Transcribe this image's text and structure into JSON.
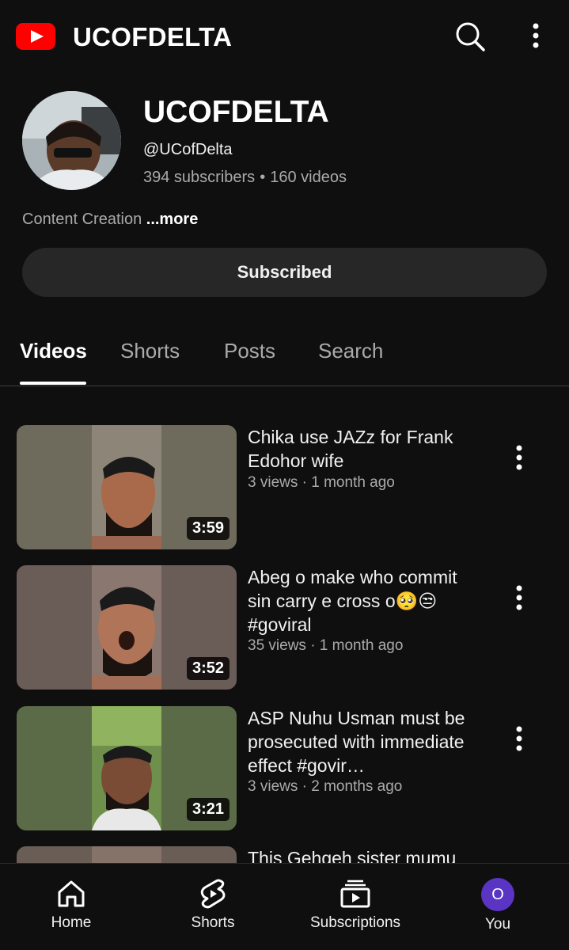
{
  "header": {
    "app_title": "UCOFDELTA",
    "logo_icon": "youtube-logo-icon",
    "search_icon": "search-icon",
    "more_icon": "more-vert-icon"
  },
  "channel": {
    "name": "UCOFDELTA",
    "handle": "@UCofDelta",
    "subscribers": "394 subscribers",
    "videos_count": "160 videos",
    "description": "Content Creation",
    "more_label": "...more",
    "subscribe_button": "Subscribed"
  },
  "tabs": [
    {
      "label": "Videos",
      "active": true
    },
    {
      "label": "Shorts",
      "active": false
    },
    {
      "label": "Posts",
      "active": false
    },
    {
      "label": "Search",
      "active": false
    }
  ],
  "videos": [
    {
      "title": "Chika use JAZz for Frank Edohor wife",
      "meta": "3 views · 1 month ago",
      "duration": "3:59"
    },
    {
      "title": "Abeg o make who commit sin carry e cross o🥺😒 #goviral",
      "meta": "35 views · 1 month ago",
      "duration": "3:52"
    },
    {
      "title": "ASP Nuhu Usman must be prosecuted with immediate effect  #govir…",
      "meta": "3 views · 2 months ago",
      "duration": "3:21"
    },
    {
      "title": "This Gehgeh sister mumu",
      "meta": "",
      "duration": ""
    }
  ],
  "bottom_nav": [
    {
      "label": "Home",
      "icon": "home-icon"
    },
    {
      "label": "Shorts",
      "icon": "shorts-icon"
    },
    {
      "label": "Subscriptions",
      "icon": "subscriptions-icon"
    },
    {
      "label": "You",
      "icon": "avatar",
      "avatar_letter": "O"
    }
  ],
  "colors": {
    "background": "#0f0f0f",
    "accent": "#ff0000",
    "button_bg": "#272727",
    "secondary_text": "#aaaaaa",
    "avatar_bg": "#5a35c4"
  }
}
